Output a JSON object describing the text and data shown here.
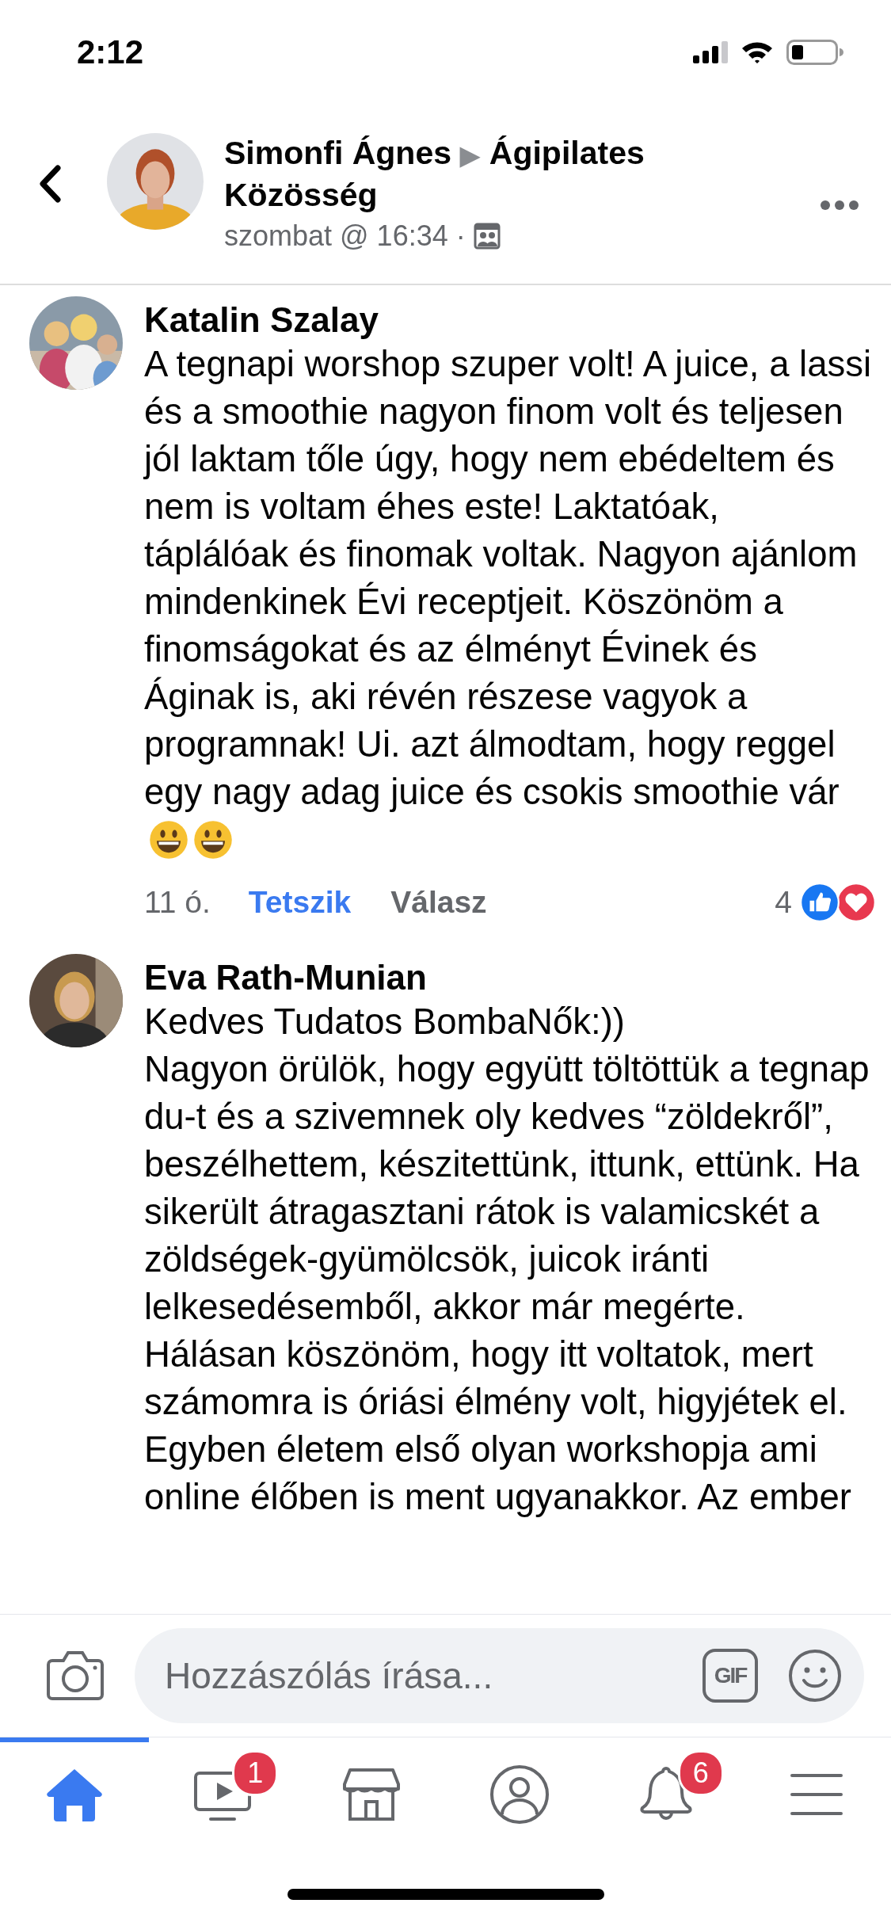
{
  "status_bar": {
    "time": "2:12"
  },
  "header": {
    "author": "Simonfi Ágnes",
    "separator": "▶",
    "group": "Ágipilates Közösség",
    "timestamp": "szombat @ 16:34 ·"
  },
  "comments": [
    {
      "author": "Katalin Szalay",
      "paragraphs": [
        "A tegnapi worshop szuper volt! A juice, a lassi és a smoothie nagyon finom volt és teljesen jól laktam tőle úgy, hogy nem ebédeltem és nem is voltam éhes este! Laktatóak, táplálóak és finomak voltak. Nagyon ajánlom mindenkinek Évi receptjeit. Köszönöm a finomságokat és az élményt Évinek és Áginak is, aki révén részese vagyok a programnak! Ui. azt álmodtam, hogy reggel egy nagy adag juice és csokis smoothie vár"
      ],
      "emoji": [
        {
          "kind": "grin"
        },
        {
          "kind": "grin"
        }
      ],
      "time": "11 ó.",
      "like_label": "Tetszik",
      "liked": true,
      "reply_label": "Válasz",
      "reaction_count": "4",
      "reactions": [
        {
          "kind": "like"
        },
        {
          "kind": "love"
        }
      ]
    },
    {
      "author": "Eva Rath-Munian",
      "paragraphs": [
        "Kedves Tudatos BombaNők:))",
        "Nagyon örülök, hogy együtt töltöttük a tegnap du-t és a szivemnek oly kedves “zöldekről”, beszélhettem,  készitettünk, ittunk, ettünk. Ha sikerült átragasztani rátok is valamicskét a zöldségek-gyümölcsök, juicok iránti lelkesedésemből, akkor már megérte.",
        "Hálásan köszönöm, hogy itt voltatok, mert számomra is óriási élmény volt, higyjétek el. Egyben életem első olyan workshopja ami online élőben is ment ugyanakkor. Az ember"
      ]
    }
  ],
  "composer": {
    "placeholder": "Hozzászólás írása...",
    "gif_label": "GIF"
  },
  "tabs": [
    {
      "kind": "home",
      "selected": true
    },
    {
      "kind": "video",
      "badge": "1",
      "selected": false
    },
    {
      "kind": "marketplace",
      "selected": false
    },
    {
      "kind": "profile",
      "selected": false
    },
    {
      "kind": "notifications",
      "badge": "6",
      "selected": false
    },
    {
      "kind": "menu",
      "selected": false
    }
  ]
}
